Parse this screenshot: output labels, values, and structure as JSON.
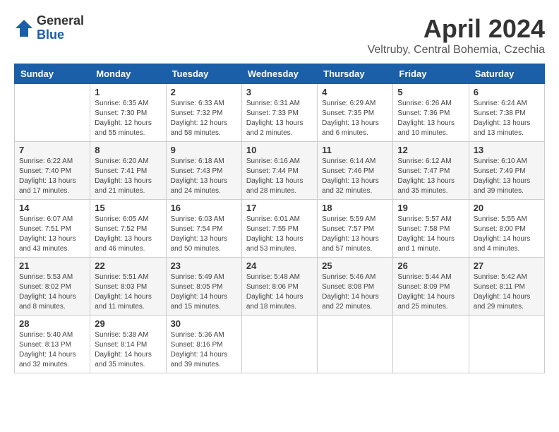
{
  "logo": {
    "general": "General",
    "blue": "Blue"
  },
  "title": "April 2024",
  "location": "Veltruby, Central Bohemia, Czechia",
  "weekdays": [
    "Sunday",
    "Monday",
    "Tuesday",
    "Wednesday",
    "Thursday",
    "Friday",
    "Saturday"
  ],
  "weeks": [
    [
      {
        "day": "",
        "info": ""
      },
      {
        "day": "1",
        "info": "Sunrise: 6:35 AM\nSunset: 7:30 PM\nDaylight: 12 hours\nand 55 minutes."
      },
      {
        "day": "2",
        "info": "Sunrise: 6:33 AM\nSunset: 7:32 PM\nDaylight: 12 hours\nand 58 minutes."
      },
      {
        "day": "3",
        "info": "Sunrise: 6:31 AM\nSunset: 7:33 PM\nDaylight: 13 hours\nand 2 minutes."
      },
      {
        "day": "4",
        "info": "Sunrise: 6:29 AM\nSunset: 7:35 PM\nDaylight: 13 hours\nand 6 minutes."
      },
      {
        "day": "5",
        "info": "Sunrise: 6:26 AM\nSunset: 7:36 PM\nDaylight: 13 hours\nand 10 minutes."
      },
      {
        "day": "6",
        "info": "Sunrise: 6:24 AM\nSunset: 7:38 PM\nDaylight: 13 hours\nand 13 minutes."
      }
    ],
    [
      {
        "day": "7",
        "info": "Sunrise: 6:22 AM\nSunset: 7:40 PM\nDaylight: 13 hours\nand 17 minutes."
      },
      {
        "day": "8",
        "info": "Sunrise: 6:20 AM\nSunset: 7:41 PM\nDaylight: 13 hours\nand 21 minutes."
      },
      {
        "day": "9",
        "info": "Sunrise: 6:18 AM\nSunset: 7:43 PM\nDaylight: 13 hours\nand 24 minutes."
      },
      {
        "day": "10",
        "info": "Sunrise: 6:16 AM\nSunset: 7:44 PM\nDaylight: 13 hours\nand 28 minutes."
      },
      {
        "day": "11",
        "info": "Sunrise: 6:14 AM\nSunset: 7:46 PM\nDaylight: 13 hours\nand 32 minutes."
      },
      {
        "day": "12",
        "info": "Sunrise: 6:12 AM\nSunset: 7:47 PM\nDaylight: 13 hours\nand 35 minutes."
      },
      {
        "day": "13",
        "info": "Sunrise: 6:10 AM\nSunset: 7:49 PM\nDaylight: 13 hours\nand 39 minutes."
      }
    ],
    [
      {
        "day": "14",
        "info": "Sunrise: 6:07 AM\nSunset: 7:51 PM\nDaylight: 13 hours\nand 43 minutes."
      },
      {
        "day": "15",
        "info": "Sunrise: 6:05 AM\nSunset: 7:52 PM\nDaylight: 13 hours\nand 46 minutes."
      },
      {
        "day": "16",
        "info": "Sunrise: 6:03 AM\nSunset: 7:54 PM\nDaylight: 13 hours\nand 50 minutes."
      },
      {
        "day": "17",
        "info": "Sunrise: 6:01 AM\nSunset: 7:55 PM\nDaylight: 13 hours\nand 53 minutes."
      },
      {
        "day": "18",
        "info": "Sunrise: 5:59 AM\nSunset: 7:57 PM\nDaylight: 13 hours\nand 57 minutes."
      },
      {
        "day": "19",
        "info": "Sunrise: 5:57 AM\nSunset: 7:58 PM\nDaylight: 14 hours\nand 1 minute."
      },
      {
        "day": "20",
        "info": "Sunrise: 5:55 AM\nSunset: 8:00 PM\nDaylight: 14 hours\nand 4 minutes."
      }
    ],
    [
      {
        "day": "21",
        "info": "Sunrise: 5:53 AM\nSunset: 8:02 PM\nDaylight: 14 hours\nand 8 minutes."
      },
      {
        "day": "22",
        "info": "Sunrise: 5:51 AM\nSunset: 8:03 PM\nDaylight: 14 hours\nand 11 minutes."
      },
      {
        "day": "23",
        "info": "Sunrise: 5:49 AM\nSunset: 8:05 PM\nDaylight: 14 hours\nand 15 minutes."
      },
      {
        "day": "24",
        "info": "Sunrise: 5:48 AM\nSunset: 8:06 PM\nDaylight: 14 hours\nand 18 minutes."
      },
      {
        "day": "25",
        "info": "Sunrise: 5:46 AM\nSunset: 8:08 PM\nDaylight: 14 hours\nand 22 minutes."
      },
      {
        "day": "26",
        "info": "Sunrise: 5:44 AM\nSunset: 8:09 PM\nDaylight: 14 hours\nand 25 minutes."
      },
      {
        "day": "27",
        "info": "Sunrise: 5:42 AM\nSunset: 8:11 PM\nDaylight: 14 hours\nand 29 minutes."
      }
    ],
    [
      {
        "day": "28",
        "info": "Sunrise: 5:40 AM\nSunset: 8:13 PM\nDaylight: 14 hours\nand 32 minutes."
      },
      {
        "day": "29",
        "info": "Sunrise: 5:38 AM\nSunset: 8:14 PM\nDaylight: 14 hours\nand 35 minutes."
      },
      {
        "day": "30",
        "info": "Sunrise: 5:36 AM\nSunset: 8:16 PM\nDaylight: 14 hours\nand 39 minutes."
      },
      {
        "day": "",
        "info": ""
      },
      {
        "day": "",
        "info": ""
      },
      {
        "day": "",
        "info": ""
      },
      {
        "day": "",
        "info": ""
      }
    ]
  ]
}
